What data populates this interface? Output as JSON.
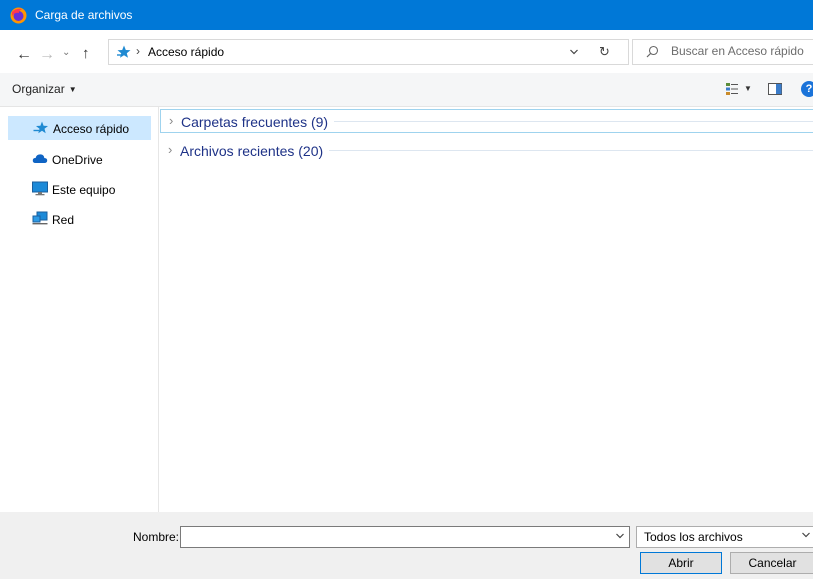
{
  "window": {
    "title": "Carga de archivos",
    "accent_color": "#0078d7"
  },
  "navigation": {
    "back_icon": "arrow-left",
    "forward_icon": "arrow-right",
    "recent_icon": "chevron-down",
    "up_icon": "arrow-up",
    "address": {
      "separator": "›",
      "location": "Acceso rápido"
    },
    "refresh_icon": "refresh",
    "search": {
      "placeholder": "Buscar en Acceso rápido",
      "value": ""
    }
  },
  "toolbar": {
    "organize_label": "Organizar",
    "help_label": "?"
  },
  "sidebar": {
    "items": [
      {
        "label": "Acceso rápido",
        "icon": "star-icon",
        "selected": true
      },
      {
        "label": "OneDrive",
        "icon": "cloud-icon",
        "selected": false
      },
      {
        "label": "Este equipo",
        "icon": "computer-icon",
        "selected": false
      },
      {
        "label": "Red",
        "icon": "network-icon",
        "selected": false
      }
    ]
  },
  "content": {
    "groups": [
      {
        "label": "Carpetas frecuentes (9)",
        "expanded": false
      },
      {
        "label": "Archivos recientes (20)",
        "expanded": false
      }
    ]
  },
  "footer": {
    "name_label": "Nombre:",
    "name_value": "",
    "filetype_value": "Todos los archivos",
    "open_label": "Abrir",
    "cancel_label": "Cancelar"
  }
}
